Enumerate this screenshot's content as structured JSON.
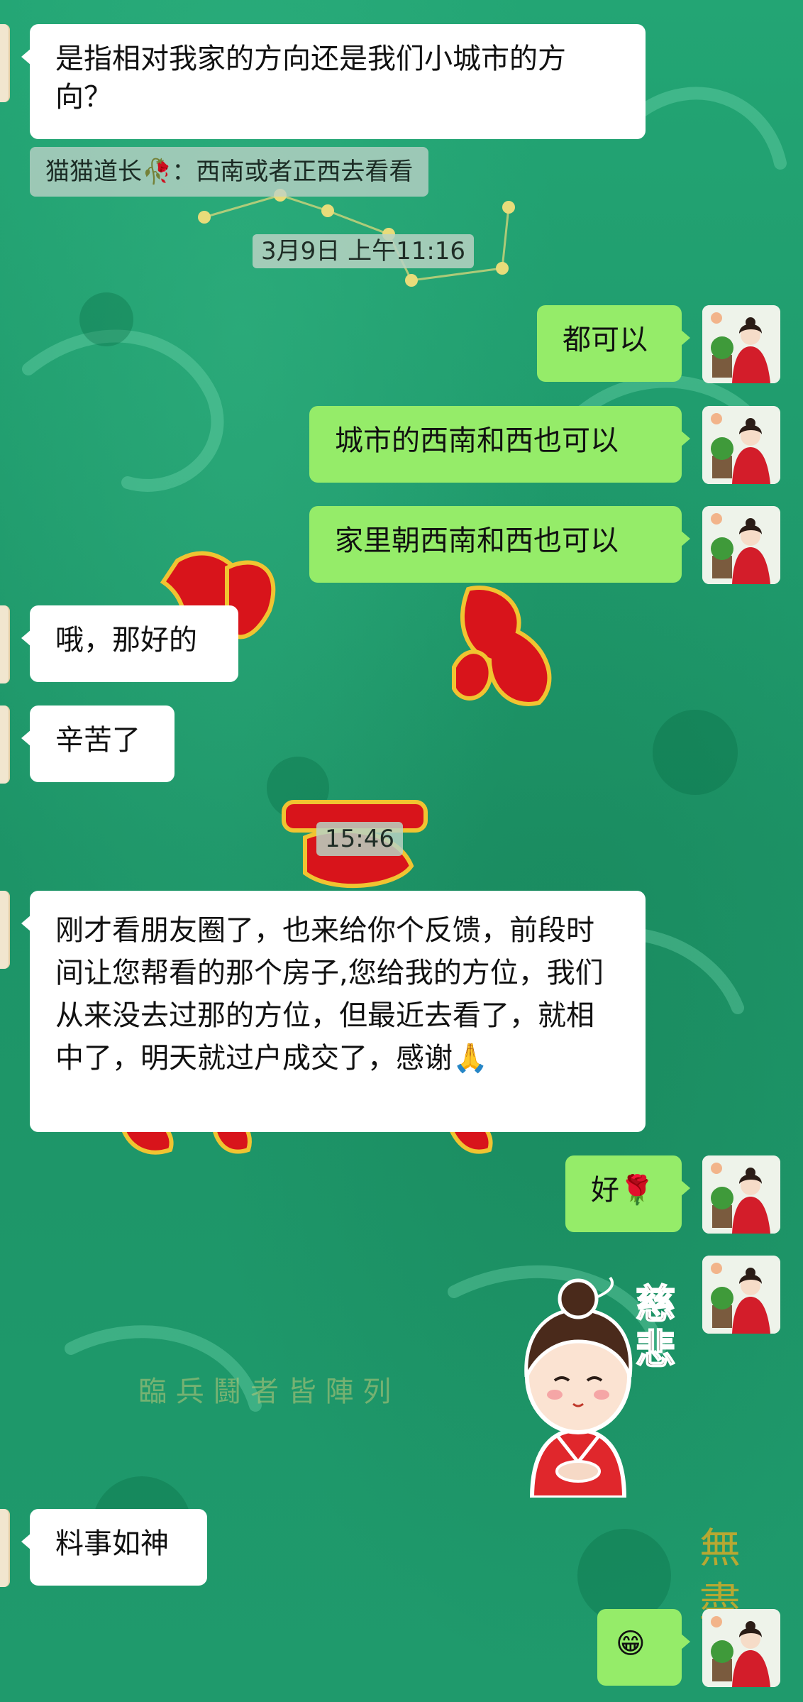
{
  "messages": {
    "m1": "是指相对我家的方向还是我们小城市的方向？",
    "quote": "猫猫道长🥀：西南或者正西去看看",
    "time1": "3月9日 上午11:16",
    "m2": "都可以",
    "m3": "城市的西南和西也可以",
    "m4": "家里朝西南和西也可以",
    "m5": "哦，那好的",
    "m6": "辛苦了",
    "time2": "15:46",
    "m7": "刚才看朋友圈了，也来给你个反馈，前段时间让您帮看的那个房子,您给我的方位，我们从来没去过那的方位，但最近去看了，就相中了，明天就过户成交了，感谢🙏",
    "m8": "好🌹",
    "sticker_text": "慈悲",
    "m9": "料事如神",
    "m10": "😁"
  },
  "background_text": {
    "mantra": "臨 兵 鬪 者 皆 陣 列",
    "corner": "無 盡"
  },
  "colors": {
    "background": "#1f9a6d",
    "incoming_bubble": "#ffffff",
    "outgoing_bubble": "#95ec69",
    "timestamp_bg": "#c8dccf"
  },
  "icons": {
    "avatar": "lady-in-red-avatar",
    "sticker": "bun-hair-girl-sticker"
  }
}
